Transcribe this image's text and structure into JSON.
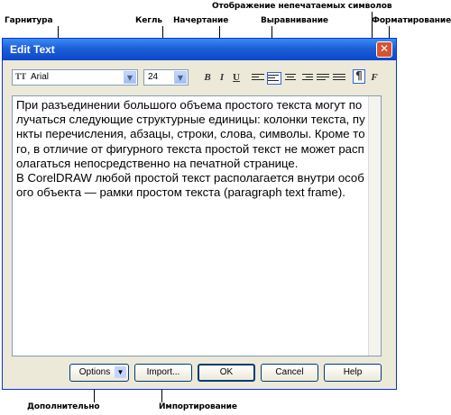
{
  "callouts": {
    "typeface": "Гарнитура",
    "size": "Кегль",
    "style": "Начертание",
    "nonprinting": "Отображение непечатаемых символов",
    "alignment": "Выравнивание",
    "formatting": "Форматирование",
    "more": "Дополнительно",
    "import": "Импортирование"
  },
  "dialog": {
    "title": "Edit Text",
    "close_glyph": "✕",
    "font_name": "Arial",
    "font_icon": "TT",
    "font_size": "24",
    "bold_glyph": "B",
    "italic_glyph": "I",
    "underline_glyph": "U",
    "nonprinting_glyph": "¶",
    "format_glyph": "F",
    "text": "При разъединении большого объема простого текста могут получаться следующие структурные единицы: колонки текста, пункты перечисления, абзацы, строки, слова, символы. Кроме того, в отличие от фигурного текста простой текст не может располагаться непосредственно на печатной странице.\nВ CorelDRAW любой простой текст располагается внутри особого объекта — рамки простом текста (paragraph text frame).",
    "buttons": {
      "options": "Options",
      "import": "Import...",
      "ok": "OK",
      "cancel": "Cancel",
      "help": "Help"
    }
  },
  "icons": [
    "combo-arrow-icon",
    "align-left-icon",
    "align-center-icon",
    "align-right-icon",
    "align-full-icon",
    "align-force-icon",
    "align-none-icon",
    "close-icon"
  ]
}
